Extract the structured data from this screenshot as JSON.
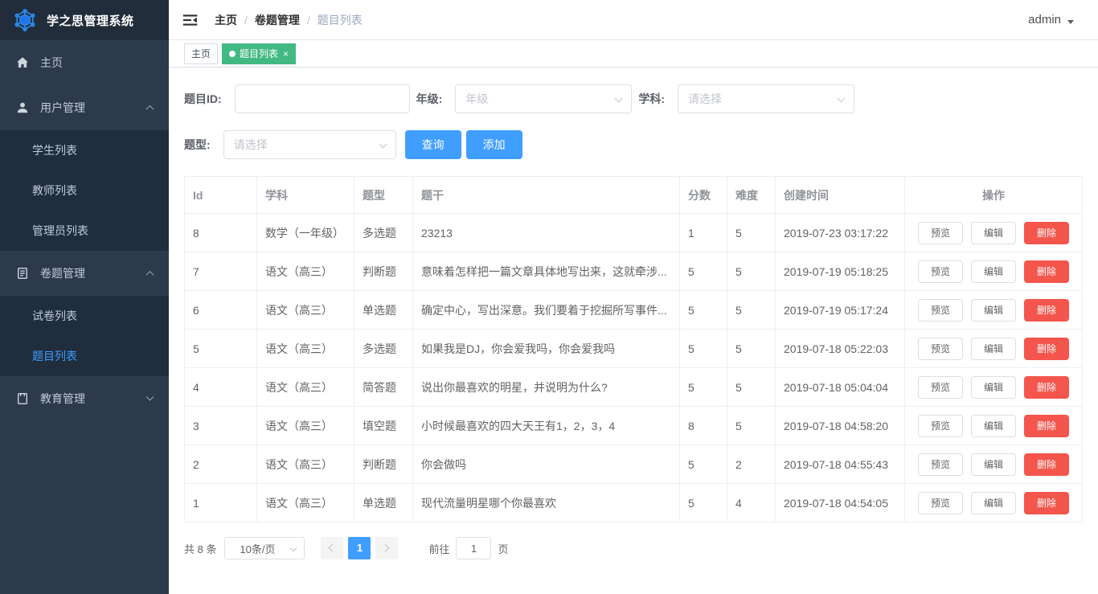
{
  "app": {
    "title": "学之思管理系统"
  },
  "sidebar": {
    "active_item": "题目列表",
    "items": [
      {
        "id": "home",
        "label": "主页",
        "icon": "home-icon"
      },
      {
        "id": "user-management",
        "label": "用户管理",
        "icon": "user-icon",
        "expanded": true,
        "children": [
          "学生列表",
          "教师列表",
          "管理员列表"
        ]
      },
      {
        "id": "paper-management",
        "label": "卷题管理",
        "icon": "document-icon",
        "expanded": true,
        "children": [
          "试卷列表",
          "题目列表"
        ]
      },
      {
        "id": "education-management",
        "label": "教育管理",
        "icon": "notebook-icon",
        "expanded": false,
        "children": []
      }
    ]
  },
  "header": {
    "breadcrumb": [
      "主页",
      "卷题管理",
      "题目列表"
    ],
    "separator": "/",
    "user": "admin"
  },
  "tabs": [
    {
      "label": "主页",
      "active": false
    },
    {
      "label": "题目列表",
      "active": true,
      "close": "×"
    }
  ],
  "filters": {
    "question_id": {
      "label": "题目ID:",
      "value": ""
    },
    "grade": {
      "label": "年级:",
      "placeholder": "年级"
    },
    "subject": {
      "label": "学科:",
      "placeholder": "请选择"
    },
    "question_type": {
      "label": "题型:",
      "placeholder": "请选择"
    },
    "search_button": "查询",
    "add_button": "添加"
  },
  "table": {
    "columns": [
      "Id",
      "学科",
      "题型",
      "题干",
      "分数",
      "难度",
      "创建时间",
      "操作"
    ],
    "actions": [
      "预览",
      "编辑",
      "删除"
    ],
    "rows": [
      {
        "id": "8",
        "subject": "数学（一年级）",
        "type": "多选题",
        "stem": "23213",
        "score": "1",
        "difficulty": "5",
        "created": "2019-07-23 03:17:22"
      },
      {
        "id": "7",
        "subject": "语文（高三）",
        "type": "判断题",
        "stem": "意味着怎样把一篇文章具体地写出来，这就牵涉...",
        "score": "5",
        "difficulty": "5",
        "created": "2019-07-19 05:18:25"
      },
      {
        "id": "6",
        "subject": "语文（高三）",
        "type": "单选题",
        "stem": "确定中心，写出深意。我们要着于挖掘所写事件...",
        "score": "5",
        "difficulty": "5",
        "created": "2019-07-19 05:17:24"
      },
      {
        "id": "5",
        "subject": "语文（高三）",
        "type": "多选题",
        "stem": "如果我是DJ，你会爱我吗，你会爱我吗",
        "score": "5",
        "difficulty": "5",
        "created": "2019-07-18 05:22:03"
      },
      {
        "id": "4",
        "subject": "语文（高三）",
        "type": "简答题",
        "stem": "说出你最喜欢的明星，并说明为什么?",
        "score": "5",
        "difficulty": "5",
        "created": "2019-07-18 05:04:04"
      },
      {
        "id": "3",
        "subject": "语文（高三）",
        "type": "填空题",
        "stem": "小时候最喜欢的四大天王有1，2，3，4",
        "score": "8",
        "difficulty": "5",
        "created": "2019-07-18 04:58:20"
      },
      {
        "id": "2",
        "subject": "语文（高三）",
        "type": "判断题",
        "stem": "你会做吗",
        "score": "5",
        "difficulty": "2",
        "created": "2019-07-18 04:55:43"
      },
      {
        "id": "1",
        "subject": "语文（高三）",
        "type": "单选题",
        "stem": "现代流量明星哪个你最喜欢",
        "score": "5",
        "difficulty": "4",
        "created": "2019-07-18 04:54:05"
      }
    ]
  },
  "pagination": {
    "total": "共 8 条",
    "page_size": "10条/页",
    "current_page": "1",
    "goto_label": "前往",
    "goto_value": "1",
    "page_unit": "页"
  },
  "colors": {
    "primary": "#409EFF",
    "tab_active": "#42b983",
    "danger": "#f4554c",
    "sidebar_bg": "#2d3a4b",
    "submenu_bg": "#1f2d3d"
  }
}
